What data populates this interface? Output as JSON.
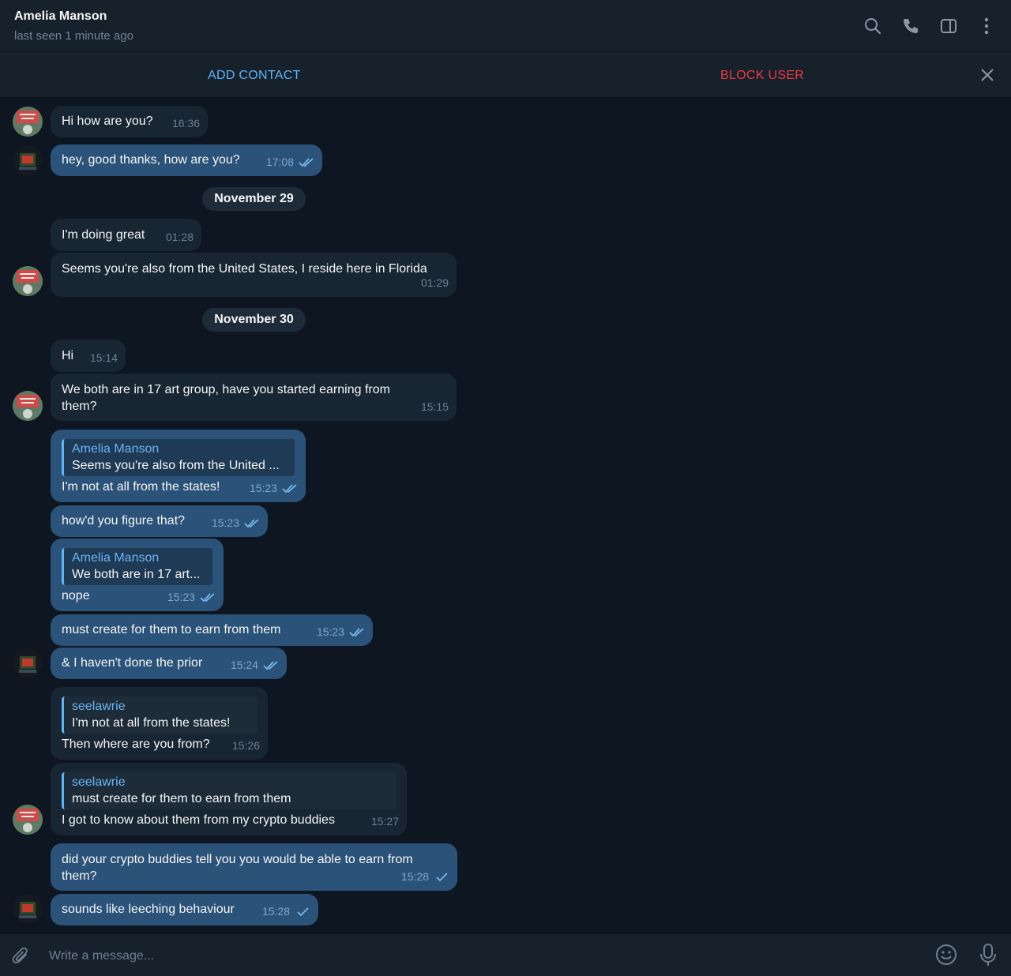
{
  "header": {
    "name": "Amelia Manson",
    "status": "last seen 1 minute ago"
  },
  "actions": {
    "add_contact": "ADD CONTACT",
    "block_user": "BLOCK USER"
  },
  "dates": [
    "November 29",
    "November 30"
  ],
  "messages": [
    {
      "text": "Hi how are you?",
      "time": "16:36"
    },
    {
      "text": "hey, good thanks, how are you?",
      "time": "17:08"
    },
    {
      "text": "I'm doing great",
      "time": "01:28"
    },
    {
      "text": "Seems you're also from the United States, I reside here in Florida",
      "time": "01:29"
    },
    {
      "text": "Hi",
      "time": "15:14"
    },
    {
      "text_line1": "We both are in 17 art group, have you started earning from",
      "text_line2": "them?",
      "time": "15:15"
    },
    {
      "reply_name": "Amelia Manson",
      "reply_text": "Seems you're also from the United ...",
      "text": "I'm not at all from the states!",
      "time": "15:23"
    },
    {
      "text": "how'd you figure that?",
      "time": "15:23"
    },
    {
      "reply_name": "Amelia Manson",
      "reply_text": "We both are in 17 art...",
      "text": "nope",
      "time": "15:23"
    },
    {
      "text": "must create for them to earn from them",
      "time": "15:23"
    },
    {
      "text": "& I haven't done the prior",
      "time": "15:24"
    },
    {
      "reply_name": "seelawrie",
      "reply_text": "I'm not at all from the states!",
      "text": "Then where are you from?",
      "time": "15:26"
    },
    {
      "reply_name": "seelawrie",
      "reply_text": "must create for them to earn from them",
      "text": "I got to know about them from my crypto buddies",
      "time": "15:27"
    },
    {
      "text_line1": "did your crypto buddies tell you you would be able to earn from",
      "text_line2": "them?",
      "time": "15:28"
    },
    {
      "text": "sounds like leeching behaviour",
      "time": "15:28"
    }
  ],
  "composer": {
    "placeholder": "Write a message..."
  },
  "colors": {
    "background": "#0e1621",
    "panel": "#17212b",
    "incoming": "#182533",
    "outgoing": "#2b5278",
    "accent": "#5eb5f7",
    "danger": "#ec3942"
  },
  "icons": [
    "search-icon",
    "phone-icon",
    "sidebar-icon",
    "more-icon",
    "close-icon",
    "paperclip-icon",
    "emoji-icon",
    "mic-icon",
    "double-check-icon",
    "single-check-icon"
  ]
}
